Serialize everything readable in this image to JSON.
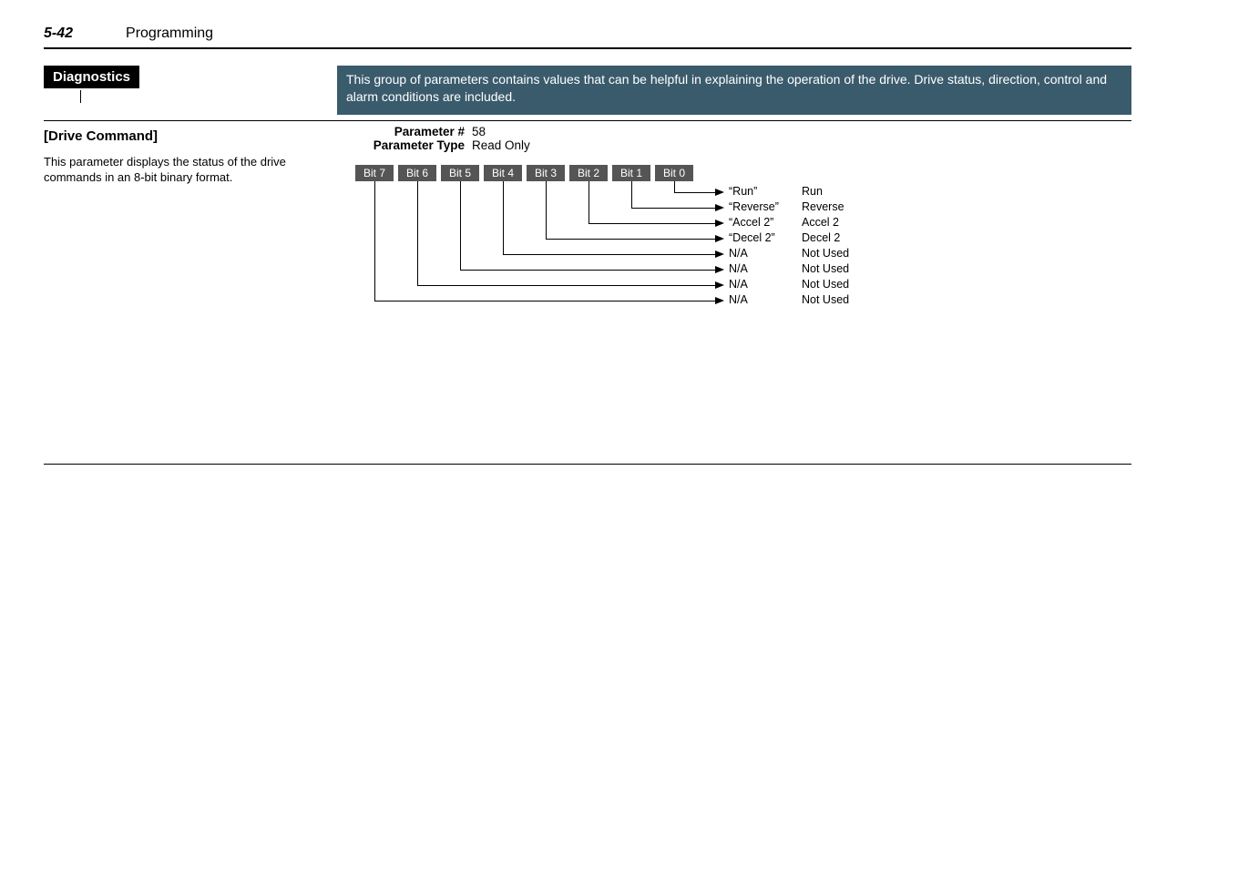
{
  "header": {
    "page_number": "5-42",
    "section": "Programming"
  },
  "group": {
    "tab_label": "Diagnostics",
    "banner_text": "This group of parameters contains values that can be helpful in explaining the operation of the drive.  Drive status, direction, control and alarm conditions are included."
  },
  "parameter": {
    "title": "[Drive Command]",
    "description": "This parameter displays the status of the drive commands in an 8-bit binary format.",
    "rows": {
      "number_label": "Parameter #",
      "number_value": "58",
      "type_label": "Parameter Type",
      "type_value": "Read Only"
    }
  },
  "bits": {
    "labels": [
      "Bit 7",
      "Bit 6",
      "Bit 5",
      "Bit 4",
      "Bit 3",
      "Bit 2",
      "Bit 1",
      "Bit 0"
    ],
    "items": [
      {
        "display": "“Run”",
        "meaning": "Run"
      },
      {
        "display": "“Reverse”",
        "meaning": "Reverse"
      },
      {
        "display": "“Accel 2”",
        "meaning": "Accel 2"
      },
      {
        "display": "“Decel 2”",
        "meaning": "Decel 2"
      },
      {
        "display": "N/A",
        "meaning": "Not Used"
      },
      {
        "display": "N/A",
        "meaning": "Not Used"
      },
      {
        "display": "N/A",
        "meaning": "Not Used"
      },
      {
        "display": "N/A",
        "meaning": "Not Used"
      }
    ]
  }
}
